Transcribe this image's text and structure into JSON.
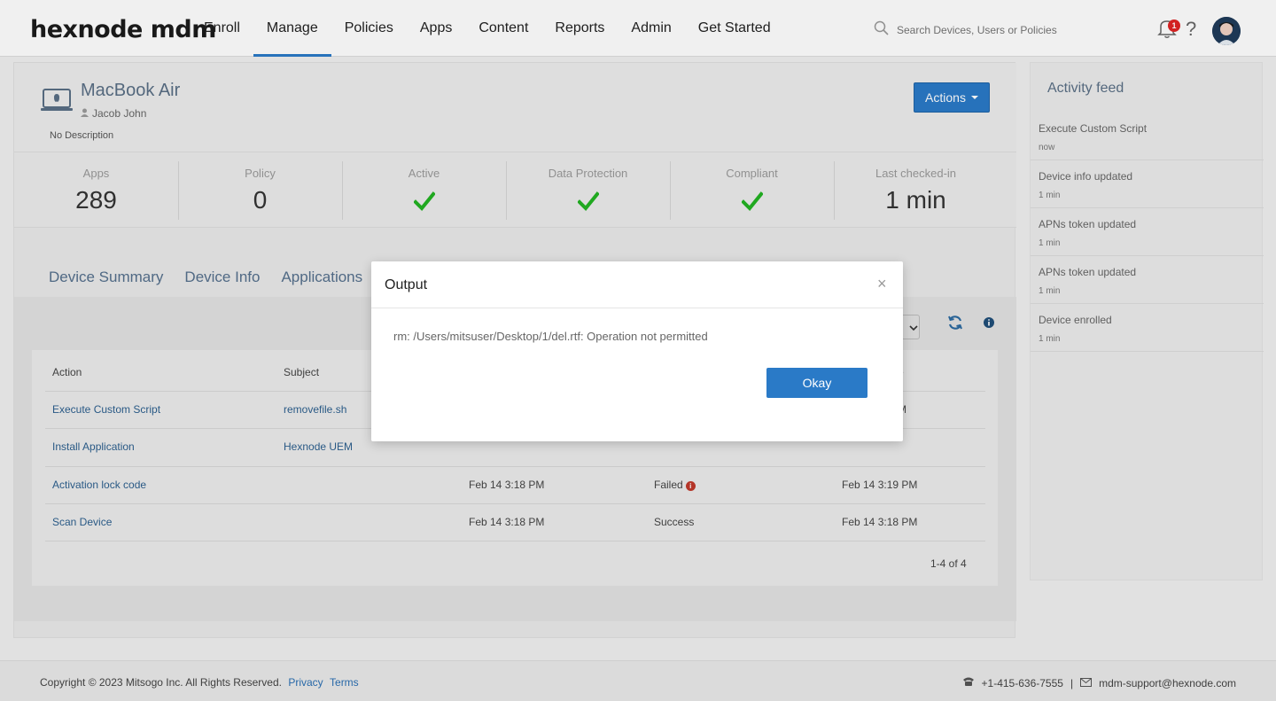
{
  "brand": {
    "logo": "hexnode mdm"
  },
  "nav": {
    "items": [
      "Enroll",
      "Manage",
      "Policies",
      "Apps",
      "Content",
      "Reports",
      "Admin",
      "Get Started"
    ],
    "active": "Manage"
  },
  "search": {
    "placeholder": "Search Devices, Users or Policies"
  },
  "notifications": {
    "count": "1"
  },
  "device": {
    "name": "MacBook Air",
    "user": "Jacob John",
    "description": "No Description",
    "actions_label": "Actions"
  },
  "stats": {
    "apps": {
      "label": "Apps",
      "value": "289"
    },
    "policy": {
      "label": "Policy",
      "value": "0"
    },
    "active": {
      "label": "Active"
    },
    "data_protection": {
      "label": "Data Protection"
    },
    "compliant": {
      "label": "Compliant"
    },
    "last_checked_in": {
      "label": "Last checked-in",
      "value": "1 min"
    }
  },
  "tabs": [
    "Device Summary",
    "Device Info",
    "Applications"
  ],
  "table": {
    "headers": {
      "action": "Action",
      "subject": "Subject",
      "date_partial": "e"
    },
    "rows": [
      {
        "action": "Execute Custom Script",
        "subject": "removefile.sh",
        "created": "",
        "status": "",
        "updated": "M"
      },
      {
        "action": "Install Application",
        "subject": "Hexnode UEM",
        "created": "",
        "status": "",
        "updated": ""
      },
      {
        "action": "Activation lock code",
        "subject": "",
        "created": "Feb 14 3:18 PM",
        "status": "Failed",
        "updated": "Feb 14 3:19 PM"
      },
      {
        "action": "Scan Device",
        "subject": "",
        "created": "Feb 14 3:18 PM",
        "status": "Success",
        "updated": "Feb 14 3:18 PM"
      }
    ],
    "pager": "1-4 of 4"
  },
  "activity_feed": {
    "title": "Activity feed",
    "items": [
      {
        "title": "Execute Custom Script",
        "time": "now"
      },
      {
        "title": "Device info updated",
        "time": "1 min"
      },
      {
        "title": "APNs token updated",
        "time": "1 min"
      },
      {
        "title": "APNs token updated",
        "time": "1 min"
      },
      {
        "title": "Device enrolled",
        "time": "1 min"
      }
    ]
  },
  "footer": {
    "copyright": "Copyright © 2023 Mitsogo Inc. All Rights Reserved.",
    "privacy": "Privacy",
    "terms": "Terms",
    "phone": "+1-415-636-7555",
    "separator": "|",
    "email": "mdm-support@hexnode.com"
  },
  "modal": {
    "title": "Output",
    "close": "×",
    "message": "rm: /Users/mitsuser/Desktop/1/del.rtf: Operation not permitted",
    "ok_label": "Okay"
  },
  "colors": {
    "accent": "#2a7ac7",
    "check": "#22b322",
    "danger": "#c0392b"
  }
}
